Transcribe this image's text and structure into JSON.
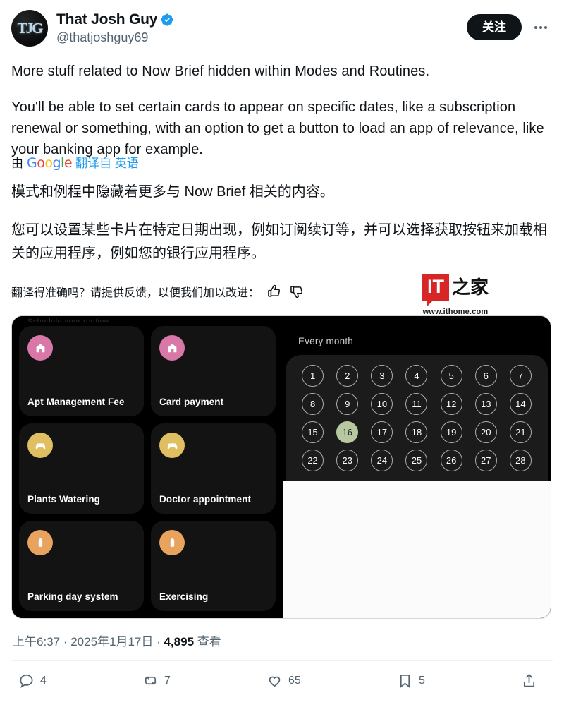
{
  "header": {
    "display_name": "That Josh Guy",
    "handle": "@thatjoshguy69",
    "avatar_monogram": "TJG",
    "verified_badge": "verified-badge",
    "follow_label": "关注",
    "more_label": "更多"
  },
  "post": {
    "paragraph_1": "More stuff related to Now Brief hidden within Modes and Routines.",
    "paragraph_2": "You'll be able to set certain cards to appear on specific dates, like a subscription renewal or something, with an option to get a button to load an app of relevance, like your banking app for example."
  },
  "translation": {
    "by_label": "由",
    "google_letters": [
      "G",
      "o",
      "o",
      "g",
      "l",
      "e"
    ],
    "from_label": "翻译自 英语",
    "zh_paragraph_1": "模式和例程中隐藏着更多与 Now Brief 相关的内容。",
    "zh_paragraph_2": "您可以设置某些卡片在特定日期出现，例如订阅续订等，并可以选择获取按钮来加载相关的应用程序，例如您的银行应用程序。",
    "feedback_prompt": "翻译得准确吗？请提供反馈，以便我们加以改进："
  },
  "watermark": {
    "brand_box": "IT",
    "brand_cn": "之家",
    "url": "www.ithome.com"
  },
  "media": {
    "cut_top_label": "Schedule your routine",
    "cards": [
      {
        "label": "Apt Management Fee",
        "icon": "home-icon",
        "color": "#d978a8"
      },
      {
        "label": "Card payment",
        "icon": "home-icon",
        "color": "#d978a8"
      },
      {
        "label": "Plants Watering",
        "icon": "gamepad-icon",
        "color": "#e0bf63"
      },
      {
        "label": "Doctor appointment",
        "icon": "gamepad-icon",
        "color": "#e0bf63"
      },
      {
        "label": "Parking day system",
        "icon": "battery-icon",
        "color": "#e8a35e"
      },
      {
        "label": "Exercising",
        "icon": "battery-icon",
        "color": "#e8a35e"
      },
      {
        "label": "",
        "icon": "battery-icon",
        "color": "#e8a35e"
      },
      {
        "label": "",
        "icon": "battery-icon",
        "color": "#e8a35e"
      }
    ],
    "calendar": {
      "title": "Every month",
      "days": [
        1,
        2,
        3,
        4,
        5,
        6,
        7,
        8,
        9,
        10,
        11,
        12,
        13,
        14,
        15,
        16,
        17,
        18,
        19,
        20,
        21,
        22,
        23,
        24,
        25,
        26,
        27,
        28
      ],
      "selected_day": 16,
      "selected_color": "#b7c8a0"
    }
  },
  "meta": {
    "time": "上午6:37",
    "separator": " · ",
    "date": "2025年1月17日",
    "views_count": "4,895",
    "views_label": "查看"
  },
  "actions": {
    "reply_count": "4",
    "repost_count": "7",
    "like_count": "65",
    "bookmark_count": "5",
    "share_label": ""
  },
  "colors": {
    "verified_blue": "#1d9bf0",
    "link_blue": "#1d9bf0",
    "text_primary": "#0f1419",
    "text_secondary": "#536471",
    "follow_bg": "#0f1419",
    "watermark_red": "#d82626"
  }
}
